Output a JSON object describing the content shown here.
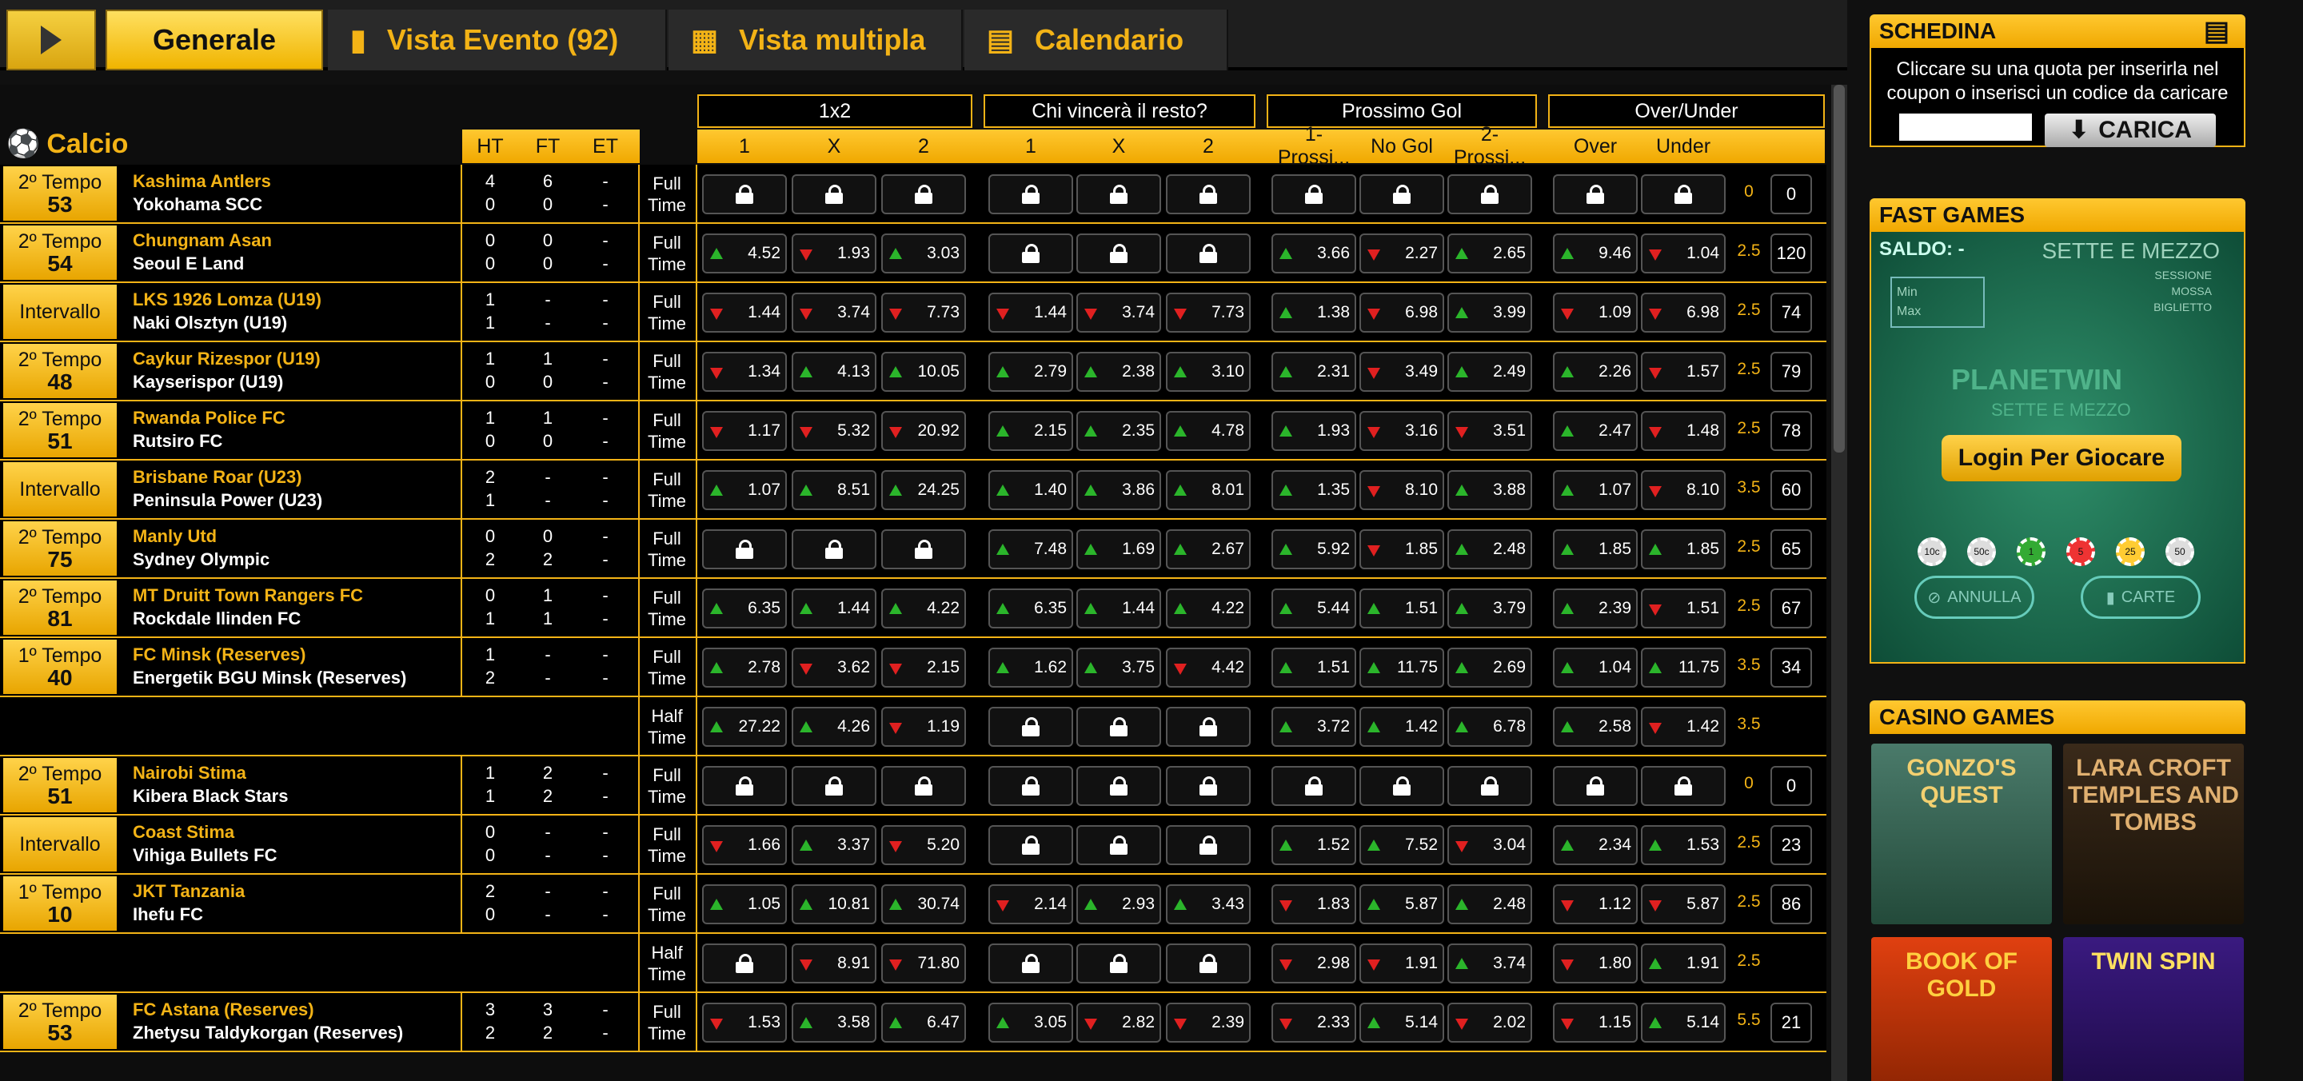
{
  "tabs": {
    "generale": "Generale",
    "vista_evento": "Vista Evento (92)",
    "vista_multipla": "Vista multipla",
    "calendario": "Calendario"
  },
  "section": {
    "sport": "Calcio"
  },
  "groups": [
    "1x2",
    "Chi vincerà il resto?",
    "Prossimo Gol",
    "Over/Under"
  ],
  "columns": {
    "ht": "HT",
    "ft": "FT",
    "et": "ET",
    "odds": [
      "1",
      "X",
      "2",
      "1",
      "X",
      "2",
      "1-Prossi...",
      "No Gol",
      "2-Prossi...",
      "Over",
      "Under"
    ]
  },
  "rows": [
    {
      "state": "2º Tempo",
      "minute": "53",
      "home": "Kashima Antlers",
      "away": "Yokohama SCC",
      "ht": [
        "4",
        "0"
      ],
      "ftsc": [
        "6",
        "0"
      ],
      "et": [
        "-",
        "-"
      ],
      "time": [
        "Full",
        "Time"
      ],
      "odds": [
        [
          "L"
        ],
        [
          "L"
        ],
        [
          "L"
        ],
        [
          "L"
        ],
        [
          "L"
        ],
        [
          "L"
        ],
        [
          "L"
        ],
        [
          "L"
        ],
        [
          "L"
        ],
        [
          "L"
        ],
        [
          "L"
        ]
      ],
      "line": "0",
      "count": "0"
    },
    {
      "state": "2º Tempo",
      "minute": "54",
      "home": "Chungnam Asan",
      "away": "Seoul E Land",
      "ht": [
        "0",
        "0"
      ],
      "ftsc": [
        "0",
        "0"
      ],
      "et": [
        "-",
        "-"
      ],
      "time": [
        "Full",
        "Time"
      ],
      "odds": [
        [
          "u",
          "4.52"
        ],
        [
          "d",
          "1.93"
        ],
        [
          "u",
          "3.03"
        ],
        [
          "L"
        ],
        [
          "L"
        ],
        [
          "L"
        ],
        [
          "u",
          "3.66"
        ],
        [
          "d",
          "2.27"
        ],
        [
          "u",
          "2.65"
        ],
        [
          "u",
          "9.46"
        ],
        [
          "d",
          "1.04"
        ]
      ],
      "line": "2.5",
      "count": "120"
    },
    {
      "state": "Intervallo",
      "minute": "",
      "home": "LKS 1926 Lomza (U19)",
      "away": "Naki Olsztyn (U19)",
      "ht": [
        "1",
        "1"
      ],
      "ftsc": [
        "-",
        "-"
      ],
      "et": [
        "-",
        "-"
      ],
      "time": [
        "Full",
        "Time"
      ],
      "odds": [
        [
          "d",
          "1.44"
        ],
        [
          "d",
          "3.74"
        ],
        [
          "d",
          "7.73"
        ],
        [
          "d",
          "1.44"
        ],
        [
          "d",
          "3.74"
        ],
        [
          "d",
          "7.73"
        ],
        [
          "u",
          "1.38"
        ],
        [
          "d",
          "6.98"
        ],
        [
          "u",
          "3.99"
        ],
        [
          "d",
          "1.09"
        ],
        [
          "d",
          "6.98"
        ]
      ],
      "line": "2.5",
      "count": "74"
    },
    {
      "state": "2º Tempo",
      "minute": "48",
      "home": "Caykur Rizespor (U19)",
      "away": "Kayserispor (U19)",
      "ht": [
        "1",
        "0"
      ],
      "ftsc": [
        "1",
        "0"
      ],
      "et": [
        "-",
        "-"
      ],
      "time": [
        "Full",
        "Time"
      ],
      "odds": [
        [
          "d",
          "1.34"
        ],
        [
          "u",
          "4.13"
        ],
        [
          "u",
          "10.05"
        ],
        [
          "u",
          "2.79"
        ],
        [
          "u",
          "2.38"
        ],
        [
          "u",
          "3.10"
        ],
        [
          "u",
          "2.31"
        ],
        [
          "d",
          "3.49"
        ],
        [
          "u",
          "2.49"
        ],
        [
          "u",
          "2.26"
        ],
        [
          "d",
          "1.57"
        ]
      ],
      "line": "2.5",
      "count": "79"
    },
    {
      "state": "2º Tempo",
      "minute": "51",
      "home": "Rwanda Police FC",
      "away": "Rutsiro FC",
      "ht": [
        "1",
        "0"
      ],
      "ftsc": [
        "1",
        "0"
      ],
      "et": [
        "-",
        "-"
      ],
      "time": [
        "Full",
        "Time"
      ],
      "odds": [
        [
          "d",
          "1.17"
        ],
        [
          "d",
          "5.32"
        ],
        [
          "d",
          "20.92"
        ],
        [
          "u",
          "2.15"
        ],
        [
          "u",
          "2.35"
        ],
        [
          "u",
          "4.78"
        ],
        [
          "u",
          "1.93"
        ],
        [
          "d",
          "3.16"
        ],
        [
          "d",
          "3.51"
        ],
        [
          "u",
          "2.47"
        ],
        [
          "d",
          "1.48"
        ]
      ],
      "line": "2.5",
      "count": "78"
    },
    {
      "state": "Intervallo",
      "minute": "",
      "home": "Brisbane Roar (U23)",
      "away": "Peninsula Power (U23)",
      "ht": [
        "2",
        "1"
      ],
      "ftsc": [
        "-",
        "-"
      ],
      "et": [
        "-",
        "-"
      ],
      "time": [
        "Full",
        "Time"
      ],
      "odds": [
        [
          "u",
          "1.07"
        ],
        [
          "u",
          "8.51"
        ],
        [
          "u",
          "24.25"
        ],
        [
          "u",
          "1.40"
        ],
        [
          "u",
          "3.86"
        ],
        [
          "u",
          "8.01"
        ],
        [
          "u",
          "1.35"
        ],
        [
          "d",
          "8.10"
        ],
        [
          "u",
          "3.88"
        ],
        [
          "u",
          "1.07"
        ],
        [
          "d",
          "8.10"
        ]
      ],
      "line": "3.5",
      "count": "60"
    },
    {
      "state": "2º Tempo",
      "minute": "75",
      "home": "Manly Utd",
      "away": "Sydney Olympic",
      "ht": [
        "0",
        "2"
      ],
      "ftsc": [
        "0",
        "2"
      ],
      "et": [
        "-",
        "-"
      ],
      "time": [
        "Full",
        "Time"
      ],
      "odds": [
        [
          "L"
        ],
        [
          "L"
        ],
        [
          "L"
        ],
        [
          "u",
          "7.48"
        ],
        [
          "u",
          "1.69"
        ],
        [
          "u",
          "2.67"
        ],
        [
          "u",
          "5.92"
        ],
        [
          "d",
          "1.85"
        ],
        [
          "u",
          "2.48"
        ],
        [
          "u",
          "1.85"
        ],
        [
          "u",
          "1.85"
        ]
      ],
      "line": "2.5",
      "count": "65"
    },
    {
      "state": "2º Tempo",
      "minute": "81",
      "home": "MT Druitt Town Rangers FC",
      "away": "Rockdale Ilinden FC",
      "ht": [
        "0",
        "1"
      ],
      "ftsc": [
        "1",
        "1"
      ],
      "et": [
        "-",
        "-"
      ],
      "time": [
        "Full",
        "Time"
      ],
      "odds": [
        [
          "u",
          "6.35"
        ],
        [
          "u",
          "1.44"
        ],
        [
          "u",
          "4.22"
        ],
        [
          "u",
          "6.35"
        ],
        [
          "u",
          "1.44"
        ],
        [
          "u",
          "4.22"
        ],
        [
          "u",
          "5.44"
        ],
        [
          "u",
          "1.51"
        ],
        [
          "u",
          "3.79"
        ],
        [
          "u",
          "2.39"
        ],
        [
          "d",
          "1.51"
        ]
      ],
      "line": "2.5",
      "count": "67"
    },
    {
      "state": "1º Tempo",
      "minute": "40",
      "home": "FC Minsk (Reserves)",
      "away": "Energetik BGU Minsk (Reserves)",
      "ht": [
        "1",
        "2"
      ],
      "ftsc": [
        "-",
        "-"
      ],
      "et": [
        "-",
        "-"
      ],
      "time": [
        "Full",
        "Time"
      ],
      "odds": [
        [
          "u",
          "2.78"
        ],
        [
          "d",
          "3.62"
        ],
        [
          "d",
          "2.15"
        ],
        [
          "u",
          "1.62"
        ],
        [
          "u",
          "3.75"
        ],
        [
          "d",
          "4.42"
        ],
        [
          "u",
          "1.51"
        ],
        [
          "u",
          "11.75"
        ],
        [
          "u",
          "2.69"
        ],
        [
          "u",
          "1.04"
        ],
        [
          "u",
          "11.75"
        ]
      ],
      "line": "3.5",
      "count": "34"
    },
    {
      "state": "",
      "minute": "",
      "home": "",
      "away": "",
      "ht": [
        "",
        ""
      ],
      "ftsc": [
        "",
        ""
      ],
      "et": [
        "",
        ""
      ],
      "time": [
        "Half",
        "Time"
      ],
      "odds": [
        [
          "u",
          "27.22"
        ],
        [
          "u",
          "4.26"
        ],
        [
          "d",
          "1.19"
        ],
        [
          "L"
        ],
        [
          "L"
        ],
        [
          "L"
        ],
        [
          "u",
          "3.72"
        ],
        [
          "u",
          "1.42"
        ],
        [
          "u",
          "6.78"
        ],
        [
          "u",
          "2.58"
        ],
        [
          "d",
          "1.42"
        ]
      ],
      "line": "3.5",
      "count": ""
    },
    {
      "state": "2º Tempo",
      "minute": "51",
      "home": "Nairobi Stima",
      "away": "Kibera Black Stars",
      "ht": [
        "1",
        "1"
      ],
      "ftsc": [
        "2",
        "2"
      ],
      "et": [
        "-",
        "-"
      ],
      "time": [
        "Full",
        "Time"
      ],
      "odds": [
        [
          "L"
        ],
        [
          "L"
        ],
        [
          "L"
        ],
        [
          "L"
        ],
        [
          "L"
        ],
        [
          "L"
        ],
        [
          "L"
        ],
        [
          "L"
        ],
        [
          "L"
        ],
        [
          "L"
        ],
        [
          "L"
        ]
      ],
      "line": "0",
      "count": "0"
    },
    {
      "state": "Intervallo",
      "minute": "",
      "home": "Coast Stima",
      "away": "Vihiga Bullets FC",
      "ht": [
        "0",
        "0"
      ],
      "ftsc": [
        "-",
        "-"
      ],
      "et": [
        "-",
        "-"
      ],
      "time": [
        "Full",
        "Time"
      ],
      "odds": [
        [
          "d",
          "1.66"
        ],
        [
          "u",
          "3.37"
        ],
        [
          "d",
          "5.20"
        ],
        [
          "L"
        ],
        [
          "L"
        ],
        [
          "L"
        ],
        [
          "u",
          "1.52"
        ],
        [
          "u",
          "7.52"
        ],
        [
          "d",
          "3.04"
        ],
        [
          "u",
          "2.34"
        ],
        [
          "u",
          "1.53"
        ]
      ],
      "line": "2.5",
      "count": "23"
    },
    {
      "state": "1º Tempo",
      "minute": "10",
      "home": "JKT Tanzania",
      "away": "Ihefu FC",
      "ht": [
        "2",
        "0"
      ],
      "ftsc": [
        "-",
        "-"
      ],
      "et": [
        "-",
        "-"
      ],
      "time": [
        "Full",
        "Time"
      ],
      "odds": [
        [
          "u",
          "1.05"
        ],
        [
          "u",
          "10.81"
        ],
        [
          "u",
          "30.74"
        ],
        [
          "d",
          "2.14"
        ],
        [
          "u",
          "2.93"
        ],
        [
          "u",
          "3.43"
        ],
        [
          "d",
          "1.83"
        ],
        [
          "u",
          "5.87"
        ],
        [
          "u",
          "2.48"
        ],
        [
          "d",
          "1.12"
        ],
        [
          "d",
          "5.87"
        ]
      ],
      "line": "2.5",
      "count": "86"
    },
    {
      "state": "",
      "minute": "",
      "home": "",
      "away": "",
      "ht": [
        "",
        ""
      ],
      "ftsc": [
        "",
        ""
      ],
      "et": [
        "",
        ""
      ],
      "time": [
        "Half",
        "Time"
      ],
      "odds": [
        [
          "L"
        ],
        [
          "d",
          "8.91"
        ],
        [
          "d",
          "71.80"
        ],
        [
          "L"
        ],
        [
          "L"
        ],
        [
          "L"
        ],
        [
          "d",
          "2.98"
        ],
        [
          "d",
          "1.91"
        ],
        [
          "u",
          "3.74"
        ],
        [
          "d",
          "1.80"
        ],
        [
          "u",
          "1.91"
        ]
      ],
      "line": "2.5",
      "count": ""
    },
    {
      "state": "2º Tempo",
      "minute": "53",
      "home": "FC Astana (Reserves)",
      "away": "Zhetysu Taldykorgan (Reserves)",
      "ht": [
        "3",
        "2"
      ],
      "ftsc": [
        "3",
        "2"
      ],
      "et": [
        "-",
        "-"
      ],
      "time": [
        "Full",
        "Time"
      ],
      "odds": [
        [
          "d",
          "1.53"
        ],
        [
          "u",
          "3.58"
        ],
        [
          "u",
          "6.47"
        ],
        [
          "u",
          "3.05"
        ],
        [
          "d",
          "2.82"
        ],
        [
          "d",
          "2.39"
        ],
        [
          "d",
          "2.33"
        ],
        [
          "u",
          "5.14"
        ],
        [
          "d",
          "2.02"
        ],
        [
          "d",
          "1.15"
        ],
        [
          "u",
          "5.14"
        ]
      ],
      "line": "5.5",
      "count": "21"
    }
  ],
  "schedina": {
    "title": "SCHEDINA",
    "text": "Cliccare su una quota per inserirla nel coupon o inserisci un codice da caricare",
    "button": "CARICA"
  },
  "fast_games": {
    "title": "FAST GAMES",
    "saldo": "SALDO: -",
    "game": "SETTE E MEZZO",
    "sessione": "SESSIONE",
    "mossa": "MOSSA",
    "biglietto": "BIGLIETTO",
    "min": "Min",
    "max": "Max",
    "brand": "PLANETWIN",
    "brand_sub": "SETTE E MEZZO",
    "login": "Login Per Giocare",
    "chips": [
      "10c",
      "50c",
      "1",
      "5",
      "25",
      "50"
    ],
    "annulla": "ANNULLA",
    "carte": "CARTE"
  },
  "casino_games": {
    "title": "CASINO GAMES",
    "games": [
      "GONZO'S QUEST",
      "LARA CROFT TEMPLES AND TOMBS",
      "BOOK OF GOLD",
      "TWIN SPIN"
    ]
  },
  "colors": {
    "accent": "#f3b316",
    "up": "#2bb52b",
    "down": "#e02020"
  }
}
